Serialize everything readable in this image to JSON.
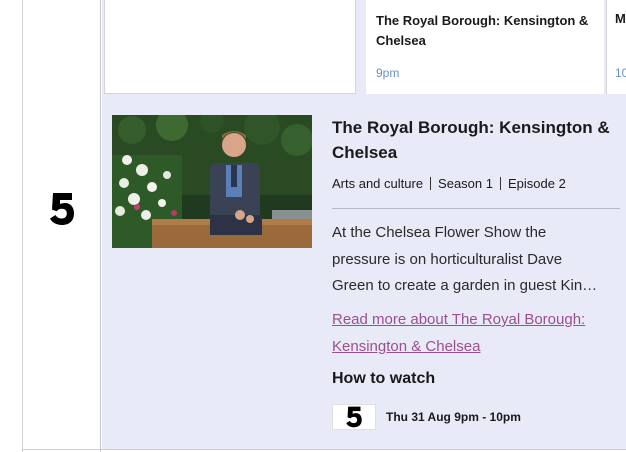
{
  "channel": {
    "logo_icon": "channel5-logo-icon"
  },
  "schedule": {
    "current": {
      "title": "The Royal Borough: Kensington & Chelsea",
      "time": "9pm"
    },
    "next": {
      "title": "M",
      "time": "10"
    }
  },
  "detail": {
    "image_icon": "programme-thumbnail-image",
    "title": "The Royal Borough: Kensington & Chelsea",
    "genre": "Arts and culture",
    "season": "Season 1",
    "episode": "Episode 2",
    "description_lines": [
      "At the Chelsea Flower Show the",
      "pressure is on horticulturalist Dave",
      "Green to create a garden in guest Kin…"
    ],
    "read_more": "Read more about The Royal Borough: Kensington & Chelsea",
    "how_to_watch": {
      "heading": "How to watch",
      "channel_icon": "channel5-logo-icon",
      "broadcast": "Thu 31 Aug 9pm - 10pm"
    }
  },
  "colors": {
    "panel_bg": "#e8eaf8",
    "time_text": "#6b8ec8",
    "link": "#9b4f8e"
  }
}
